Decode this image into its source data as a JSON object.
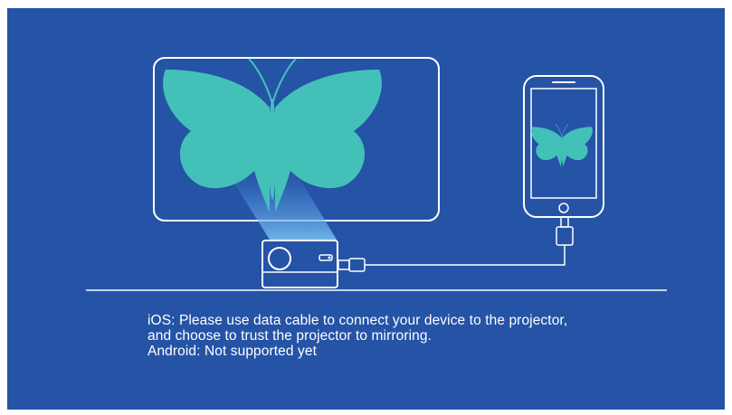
{
  "instructions": {
    "ios_line_1": "iOS: Please use data cable to connect your device to the projector,",
    "ios_line_2": "and choose to trust the projector to mirroring.",
    "android": "Android: Not supported yet"
  },
  "colors": {
    "background": "#2553a6",
    "butterfly": "#43c1b8",
    "line": "#ffffff",
    "beam": "#5fa9e8"
  },
  "icons": {
    "screen": "projection-screen-icon",
    "butterfly": "butterfly-icon",
    "projector": "projector-icon",
    "phone": "smartphone-icon",
    "cable": "usb-cable-icon"
  }
}
